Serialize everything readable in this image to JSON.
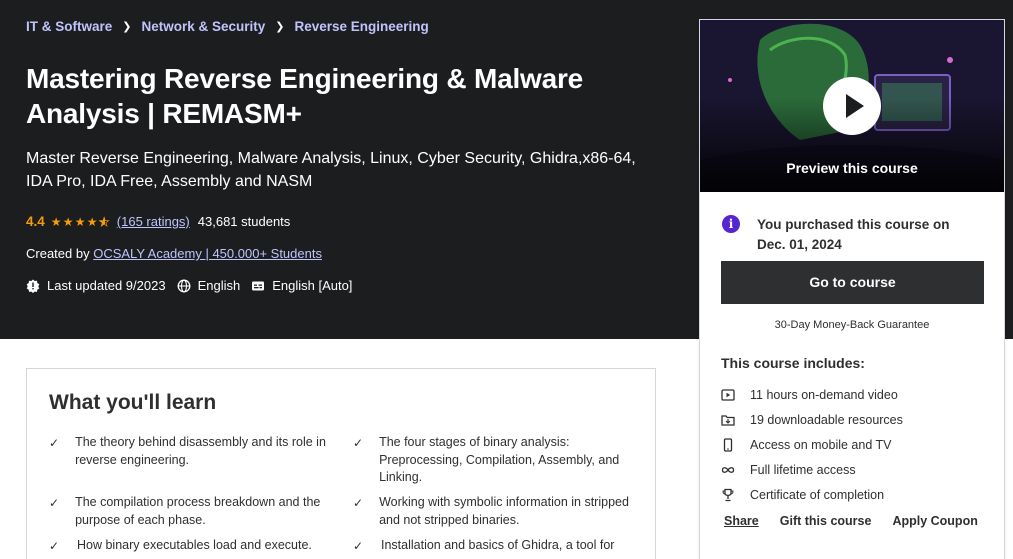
{
  "breadcrumb": [
    "IT & Software",
    "Network & Security",
    "Reverse Engineering"
  ],
  "title": "Mastering Reverse Engineering & Malware Analysis | REMASM+",
  "subtitle": "Master Reverse Engineering, Malware Analysis, Linux, Cyber Security, Ghidra,x86-64, IDA Pro, IDA Free, Assembly and NASM",
  "rating": {
    "value": "4.4",
    "stars": 4.4,
    "count_text": "(165 ratings)",
    "students": "43,681 students"
  },
  "created": {
    "prefix": "Created by",
    "author": "OCSALY Academy | 450.000+ Students"
  },
  "meta": {
    "updated": "Last updated 9/2023",
    "language": "English",
    "captions": "English [Auto]"
  },
  "sidebar": {
    "preview_label": "Preview this course",
    "purchased": "You purchased this course on Dec. 01, 2024",
    "go_button": "Go to course",
    "guarantee": "30-Day Money-Back Guarantee",
    "includes_title": "This course includes:",
    "includes": [
      {
        "icon": "video-icon",
        "text": "11 hours on-demand video"
      },
      {
        "icon": "folder-download-icon",
        "text": "19 downloadable resources"
      },
      {
        "icon": "mobile-icon",
        "text": "Access on mobile and TV"
      },
      {
        "icon": "infinity-icon",
        "text": "Full lifetime access"
      },
      {
        "icon": "trophy-icon",
        "text": "Certificate of completion"
      }
    ],
    "links": [
      "Share",
      "Gift this course",
      "Apply Coupon"
    ]
  },
  "learn": {
    "title": "What you'll learn",
    "items": [
      "The theory behind disassembly and its role in reverse engineering.",
      "The four stages of binary analysis: Preprocessing, Compilation, Assembly, and Linking.",
      "The compilation process breakdown and the purpose of each phase.",
      "Working with symbolic information in stripped and not stripped binaries.",
      "How binary executables load and execute.",
      "Installation and basics of Ghidra, a tool for"
    ]
  },
  "colors": {
    "hero_bg": "#1c1d1f",
    "link": "#c0c4fc",
    "star": "#f69c08",
    "info": "#5624d0",
    "button": "#2d2f31"
  }
}
